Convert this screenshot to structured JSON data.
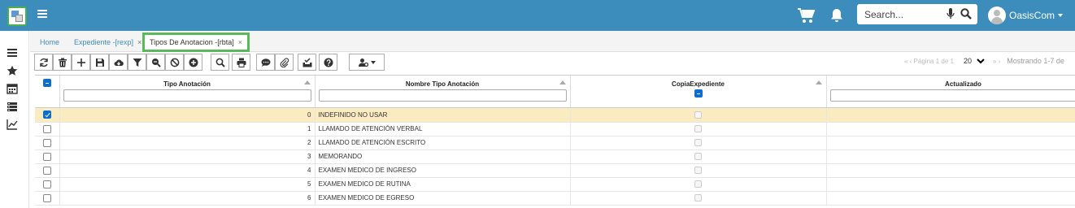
{
  "header": {
    "search_placeholder": "Search...",
    "user_name": "OasisCom",
    "icons": [
      "logo-icon",
      "menu-icon",
      "cart-icon",
      "bell-icon",
      "mic-icon",
      "search-icon",
      "avatar",
      "chevron-down-icon"
    ],
    "brand_color": "#3c8dbc"
  },
  "sidebar": {
    "icons": [
      "menu-icon",
      "star-icon",
      "calendar-icon",
      "list-icon",
      "chart-icon"
    ]
  },
  "tabs": [
    {
      "label": "Home",
      "closable": false
    },
    {
      "label": "Expediente -[rexp]",
      "closable": true,
      "close": "×"
    },
    {
      "label": "Tipos De Anotacion -[rbta]",
      "closable": true,
      "close": "×",
      "active": true
    }
  ],
  "toolbar": {
    "buttons": [
      "refresh",
      "delete",
      "add",
      "save",
      "cloud-download",
      "filter",
      "zoom-out",
      "cancel",
      "add-circle",
      "search",
      "print",
      "comment",
      "attach",
      "approve",
      "help",
      "user-settings"
    ]
  },
  "pager": {
    "prev": "« ‹ Página 1 de 1",
    "page_size": "20",
    "next": "» ›",
    "showing": "Mostrando 1-7 de"
  },
  "grid": {
    "columns": [
      "Tipo Anotación",
      "Nombre Tipo Anotación",
      "CopiaExpediente",
      "Actualizado"
    ],
    "rows": [
      {
        "tipo": "0",
        "nombre": "INDEFINIDO NO USAR",
        "selected": true
      },
      {
        "tipo": "1",
        "nombre": "LLAMADO DE ATENCIÓN VERBAL"
      },
      {
        "tipo": "2",
        "nombre": "LLAMADO DE ATENCIÓN ESCRITO"
      },
      {
        "tipo": "3",
        "nombre": "MEMORANDO"
      },
      {
        "tipo": "4",
        "nombre": "EXAMEN MEDICO DE INGRESO"
      },
      {
        "tipo": "5",
        "nombre": "EXAMEN MEDICO DE RUTINA"
      },
      {
        "tipo": "6",
        "nombre": "EXAMEN MEDICO DE EGRESO"
      }
    ]
  },
  "colors": {
    "selected_row": "#faecc0",
    "active_tab_border": "#5cb85c",
    "checkbox_blue": "#0a6ed1"
  }
}
